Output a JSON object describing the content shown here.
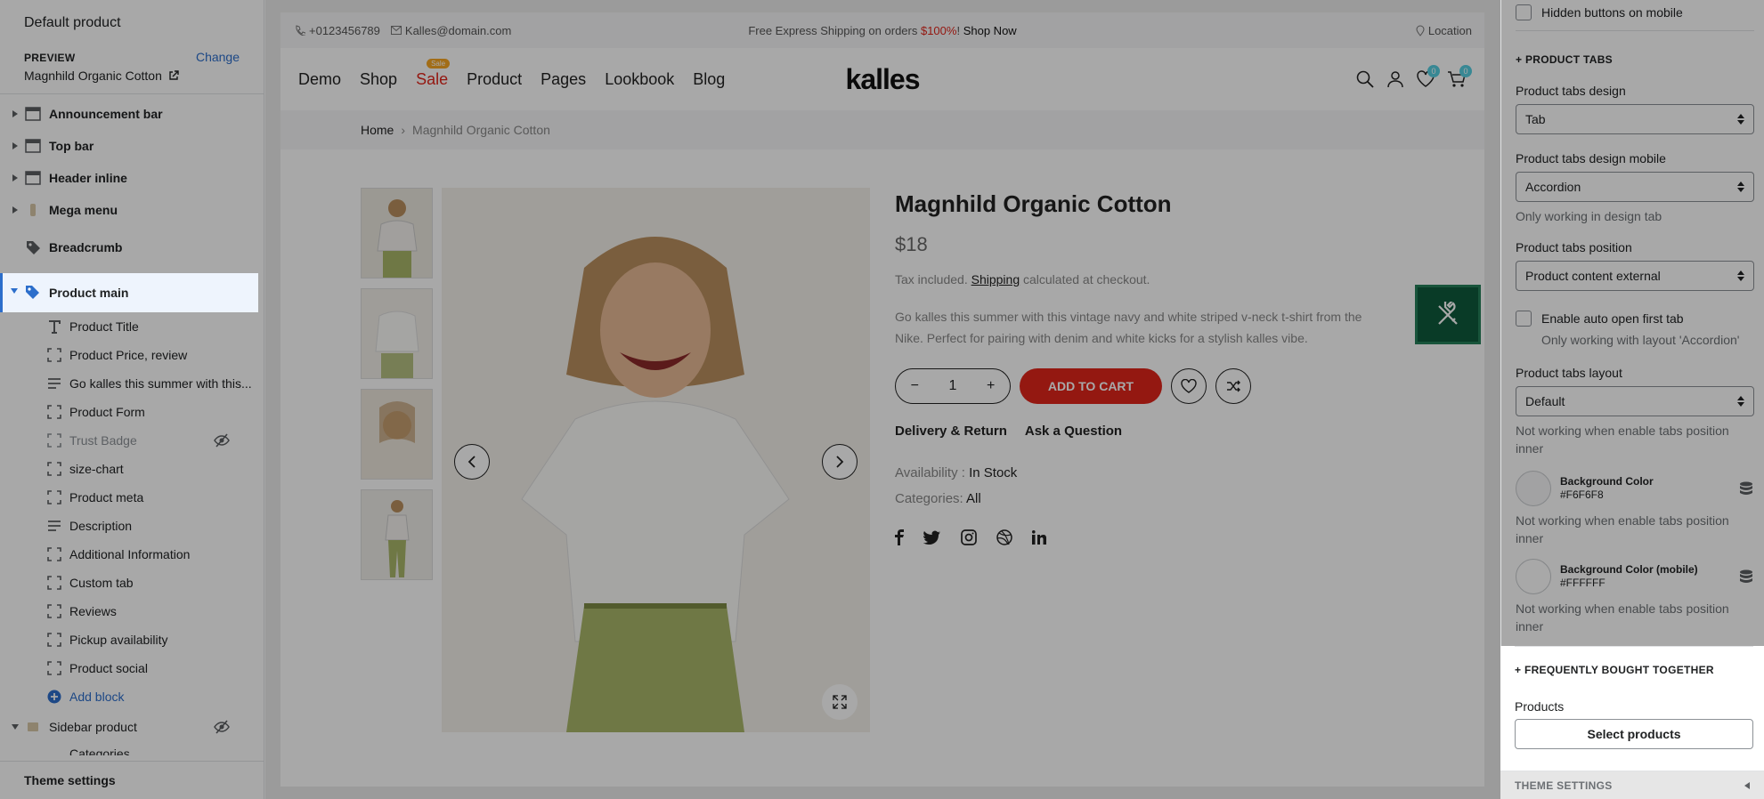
{
  "sidebar": {
    "title": "Default product",
    "preview_label": "PREVIEW",
    "change_label": "Change",
    "preview_product": "Magnhild Organic Cotton",
    "sections": [
      {
        "label": "Announcement bar",
        "icon": "layout-icon"
      },
      {
        "label": "Top bar",
        "icon": "layout-icon"
      },
      {
        "label": "Header inline",
        "icon": "layout-icon"
      },
      {
        "label": "Mega menu",
        "icon": "mega-menu-icon"
      },
      {
        "label": "Breadcrumb",
        "icon": "tag-icon"
      },
      {
        "label": "Product main",
        "icon": "tag-icon"
      }
    ],
    "blocks": [
      {
        "label": "Product Title",
        "icon": "text-icon"
      },
      {
        "label": "Product Price, review",
        "icon": "block-icon"
      },
      {
        "label": "Go kalles this summer with this...",
        "icon": "paragraph-icon"
      },
      {
        "label": "Product Form",
        "icon": "block-icon"
      },
      {
        "label": "Trust Badge",
        "icon": "block-icon",
        "hidden": true
      },
      {
        "label": "size-chart",
        "icon": "block-icon"
      },
      {
        "label": "Product meta",
        "icon": "block-icon"
      },
      {
        "label": "Description",
        "icon": "paragraph-icon"
      },
      {
        "label": "Additional Information",
        "icon": "block-icon"
      },
      {
        "label": "Custom tab",
        "icon": "block-icon"
      },
      {
        "label": "Reviews",
        "icon": "block-icon"
      },
      {
        "label": "Pickup availability",
        "icon": "block-icon"
      },
      {
        "label": "Product social",
        "icon": "block-icon"
      }
    ],
    "add_block": "Add block",
    "sidebar_product": "Sidebar product",
    "categories_partial": "Categories",
    "footer": "Theme settings"
  },
  "store": {
    "phone": "+0123456789",
    "email": "Kalles@domain.com",
    "promo_prefix": "Free Express Shipping on orders ",
    "promo_highlight": "$100%",
    "promo_sep": "!",
    "promo_link": "Shop Now",
    "location": "Location",
    "nav": [
      "Demo",
      "Shop",
      "Sale",
      "Product",
      "Pages",
      "Lookbook",
      "Blog"
    ],
    "sale_badge": "Sale",
    "logo": "kalles",
    "wishlist_count": "0",
    "cart_count": "0",
    "breadcrumb_home": "Home",
    "breadcrumb_sep": "›",
    "breadcrumb_current": "Magnhild Organic Cotton",
    "product": {
      "title": "Magnhild Organic Cotton",
      "price": "$18",
      "tax_prefix": "Tax included. ",
      "tax_link": "Shipping",
      "tax_suffix": " calculated at checkout.",
      "description": "Go kalles this summer with this vintage navy and white striped v-neck t-shirt from the Nike. Perfect for pairing with denim and white kicks for a stylish kalles vibe.",
      "qty": "1",
      "add_to_cart": "ADD TO CART",
      "delivery": "Delivery & Return",
      "ask": "Ask a Question",
      "availability_label": "Availability : ",
      "availability_value": "In Stock",
      "categories_label": "Categories: ",
      "categories_value": "All"
    }
  },
  "settings": {
    "hidden_buttons": "Hidden buttons on mobile",
    "product_tabs_header": "+ PRODUCT TABS",
    "tabs_design_label": "Product tabs design",
    "tabs_design_value": "Tab",
    "tabs_design_mobile_label": "Product tabs design mobile",
    "tabs_design_mobile_value": "Accordion",
    "tabs_design_mobile_help": "Only working in design tab",
    "tabs_position_label": "Product tabs position",
    "tabs_position_value": "Product content external",
    "auto_open_label": "Enable auto open first tab",
    "auto_open_help": "Only working with layout 'Accordion'",
    "tabs_layout_label": "Product tabs layout",
    "tabs_layout_value": "Default",
    "tabs_layout_help": "Not working when enable tabs position inner",
    "bg_color_label": "Background Color",
    "bg_color_value": "#F6F6F8",
    "bg_color_help": "Not working when enable tabs position inner",
    "bg_color_mobile_label": "Background Color (mobile)",
    "bg_color_mobile_value": "#FFFFFF",
    "bg_color_mobile_help": "Not working when enable tabs position inner",
    "fbt_header": "+ FREQUENTLY BOUGHT TOGETHER",
    "products_label": "Products",
    "select_products": "Select products",
    "theme_settings": "THEME SETTINGS"
  },
  "colors": {
    "accent": "#2c6ecb",
    "sale": "#e1251b",
    "tools_green": "#0f5a3c"
  }
}
